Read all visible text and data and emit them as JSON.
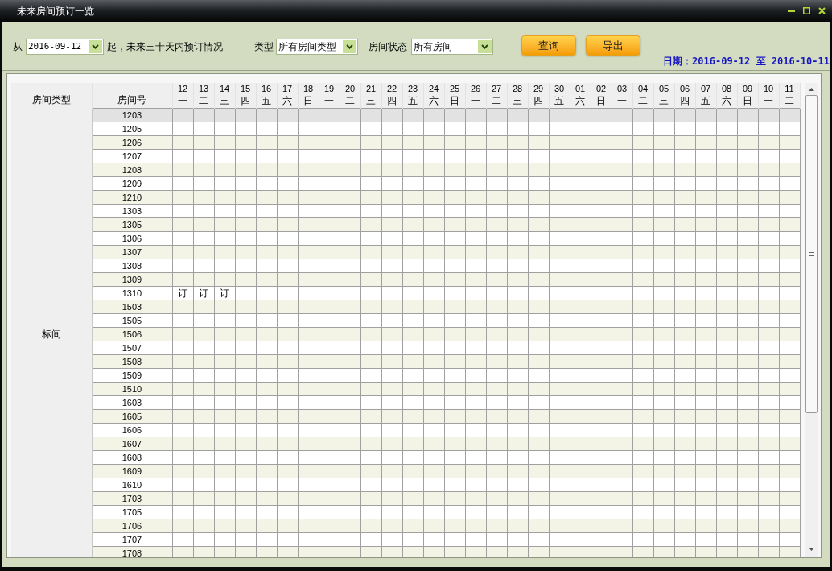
{
  "window": {
    "title": "未来房间预订一览"
  },
  "toolbar": {
    "from_label": "从",
    "date_field": {
      "value": "2016-09-12"
    },
    "range_text": "起，未来三十天内预订情况",
    "type_label": "类型",
    "type_select": {
      "value": "所有房间类型"
    },
    "status_label": "房间状态",
    "status_select": {
      "value": "所有房间"
    },
    "buttons": [
      "查询",
      "导出"
    ],
    "date_range": "日期：2016-09-12 至 2016-10-11"
  },
  "table": {
    "columns": [
      "房间类型",
      "房间号"
    ],
    "days": [
      {
        "day": "12",
        "weekday": "一"
      },
      {
        "day": "13",
        "weekday": "二"
      },
      {
        "day": "14",
        "weekday": "三"
      },
      {
        "day": "15",
        "weekday": "四"
      },
      {
        "day": "16",
        "weekday": "五"
      },
      {
        "day": "17",
        "weekday": "六"
      },
      {
        "day": "18",
        "weekday": "日"
      },
      {
        "day": "19",
        "weekday": "一"
      },
      {
        "day": "20",
        "weekday": "二"
      },
      {
        "day": "21",
        "weekday": "三"
      },
      {
        "day": "22",
        "weekday": "四"
      },
      {
        "day": "23",
        "weekday": "五"
      },
      {
        "day": "24",
        "weekday": "六"
      },
      {
        "day": "25",
        "weekday": "日"
      },
      {
        "day": "26",
        "weekday": "一"
      },
      {
        "day": "27",
        "weekday": "二"
      },
      {
        "day": "28",
        "weekday": "三"
      },
      {
        "day": "29",
        "weekday": "四"
      },
      {
        "day": "30",
        "weekday": "五"
      },
      {
        "day": "01",
        "weekday": "六"
      },
      {
        "day": "02",
        "weekday": "日"
      },
      {
        "day": "03",
        "weekday": "一"
      },
      {
        "day": "04",
        "weekday": "二"
      },
      {
        "day": "05",
        "weekday": "三"
      },
      {
        "day": "06",
        "weekday": "四"
      },
      {
        "day": "07",
        "weekday": "五"
      },
      {
        "day": "08",
        "weekday": "六"
      },
      {
        "day": "09",
        "weekday": "日"
      },
      {
        "day": "10",
        "weekday": "一"
      },
      {
        "day": "11",
        "weekday": "二"
      }
    ],
    "room_type": "标间",
    "rows": [
      {
        "room": "1203",
        "selected": true
      },
      {
        "room": "1205",
        "selected": false
      },
      {
        "room": "1206",
        "selected": false
      },
      {
        "room": "1207",
        "selected": false
      },
      {
        "room": "1208",
        "selected": false
      },
      {
        "room": "1209",
        "selected": false
      },
      {
        "room": "1210",
        "selected": false
      },
      {
        "room": "1303",
        "selected": false
      },
      {
        "room": "1305",
        "selected": false
      },
      {
        "room": "1306",
        "selected": false
      },
      {
        "room": "1307",
        "selected": false
      },
      {
        "room": "1308",
        "selected": false
      },
      {
        "room": "1309",
        "selected": false
      },
      {
        "room": "1310",
        "selected": false,
        "cells": [
          {
            "booked": true,
            "text": "订"
          },
          {
            "booked": true,
            "text": "订"
          },
          {
            "booked": true,
            "text": "订"
          },
          {
            "booked": false
          },
          {
            "booked": false
          },
          {
            "booked": false
          },
          {
            "booked": false
          },
          {
            "booked": false
          },
          {
            "booked": false
          },
          {
            "booked": false
          },
          {
            "booked": false
          },
          {
            "booked": false
          },
          {
            "booked": false
          },
          {
            "booked": false
          },
          {
            "booked": false
          },
          {
            "booked": false
          },
          {
            "booked": false
          },
          {
            "booked": false
          },
          {
            "booked": false
          },
          {
            "booked": false
          },
          {
            "booked": false
          },
          {
            "booked": false
          },
          {
            "booked": false
          },
          {
            "booked": false
          },
          {
            "booked": false
          },
          {
            "booked": false
          },
          {
            "booked": false
          },
          {
            "booked": false
          },
          {
            "booked": false
          },
          {
            "booked": false
          }
        ]
      },
      {
        "room": "1503",
        "selected": false
      },
      {
        "room": "1505",
        "selected": false
      },
      {
        "room": "1506",
        "selected": false
      },
      {
        "room": "1507",
        "selected": false
      },
      {
        "room": "1508",
        "selected": false
      },
      {
        "room": "1509",
        "selected": false
      },
      {
        "room": "1510",
        "selected": false
      },
      {
        "room": "1603",
        "selected": false
      },
      {
        "room": "1605",
        "selected": false
      },
      {
        "room": "1606",
        "selected": false
      },
      {
        "room": "1607",
        "selected": false
      },
      {
        "room": "1608",
        "selected": false
      },
      {
        "room": "1609",
        "selected": false
      },
      {
        "room": "1610",
        "selected": false
      },
      {
        "room": "1703",
        "selected": false
      },
      {
        "room": "1705",
        "selected": false
      },
      {
        "room": "1706",
        "selected": false
      },
      {
        "room": "1707",
        "selected": false
      },
      {
        "room": "1708",
        "selected": false
      }
    ]
  }
}
